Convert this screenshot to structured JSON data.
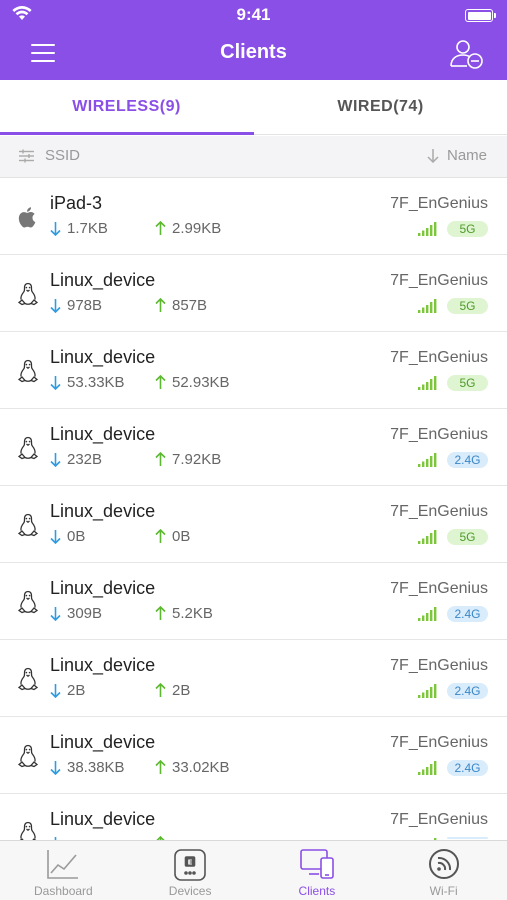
{
  "status_bar": {
    "time": "9:41"
  },
  "nav": {
    "title": "Clients"
  },
  "tabs": [
    {
      "label": "WIRELESS(9)",
      "active": true
    },
    {
      "label": "WIRED(74)",
      "active": false
    }
  ],
  "sort_bar": {
    "left_label": "SSID",
    "right_label": "Name"
  },
  "clients": [
    {
      "name": "iPad-3",
      "os_icon": "apple-icon",
      "down": "1.7KB",
      "up": "2.99KB",
      "ssid": "7F_EnGenius",
      "band": "5G"
    },
    {
      "name": "Linux_device",
      "os_icon": "linux-icon",
      "down": "978B",
      "up": "857B",
      "ssid": "7F_EnGenius",
      "band": "5G"
    },
    {
      "name": "Linux_device",
      "os_icon": "linux-icon",
      "down": "53.33KB",
      "up": "52.93KB",
      "ssid": "7F_EnGenius",
      "band": "5G"
    },
    {
      "name": "Linux_device",
      "os_icon": "linux-icon",
      "down": "232B",
      "up": "7.92KB",
      "ssid": "7F_EnGenius",
      "band": "2.4G"
    },
    {
      "name": "Linux_device",
      "os_icon": "linux-icon",
      "down": "0B",
      "up": "0B",
      "ssid": "7F_EnGenius",
      "band": "5G"
    },
    {
      "name": "Linux_device",
      "os_icon": "linux-icon",
      "down": "309B",
      "up": "5.2KB",
      "ssid": "7F_EnGenius",
      "band": "2.4G"
    },
    {
      "name": "Linux_device",
      "os_icon": "linux-icon",
      "down": "2B",
      "up": "2B",
      "ssid": "7F_EnGenius",
      "band": "2.4G"
    },
    {
      "name": "Linux_device",
      "os_icon": "linux-icon",
      "down": "38.38KB",
      "up": "33.02KB",
      "ssid": "7F_EnGenius",
      "band": "2.4G"
    },
    {
      "name": "Linux_device",
      "os_icon": "linux-icon",
      "down": "",
      "up": "",
      "ssid": "7F_EnGenius",
      "band": ""
    }
  ],
  "tabbar": [
    {
      "label": "Dashboard",
      "icon": "dashboard-icon",
      "active": false
    },
    {
      "label": "Devices",
      "icon": "devices-icon",
      "active": false
    },
    {
      "label": "Clients",
      "icon": "clients-icon",
      "active": true
    },
    {
      "label": "Wi-Fi",
      "icon": "wifi-icon",
      "active": false
    }
  ],
  "colors": {
    "accent": "#8a4fe6",
    "down_arrow": "#2f9be0",
    "up_arrow": "#5cb82f",
    "signal": "#7cc63b",
    "band_5g_bg": "#dff5d2",
    "band_24g_bg": "#d9ecfb"
  }
}
